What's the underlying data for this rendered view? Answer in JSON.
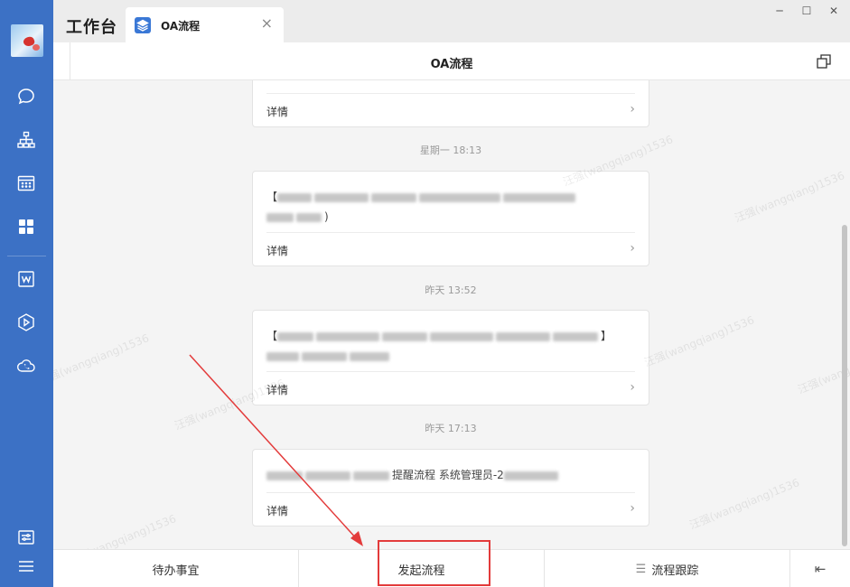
{
  "app": {
    "title": "工作台"
  },
  "tab": {
    "label": "OA流程",
    "close": "×"
  },
  "window": {
    "minimize": "─",
    "maximize": "☐",
    "close": "✕"
  },
  "header": {
    "title": "OA流程"
  },
  "sidebar": {
    "icons": [
      "chat-icon",
      "org-chart-icon",
      "calendar-icon",
      "apps-grid-icon",
      "wps-doc-icon",
      "play-hex-icon",
      "phone-cloud-icon",
      "settings-sliders-icon",
      "menu-icon"
    ]
  },
  "feed": {
    "detail_label": "详情",
    "chevron": "›",
    "items": [
      {
        "time": "",
        "text_prefix": "",
        "text_suffix": ""
      },
      {
        "time": "星期一 18:13",
        "text_prefix": "【",
        "text_suffix": ")"
      },
      {
        "time": "昨天 13:52",
        "text_prefix": "【",
        "text_suffix": "】"
      },
      {
        "time": "昨天 17:13",
        "text_prefix": "【",
        "text_suffix": "提醒流程 系统管理员-2"
      }
    ]
  },
  "watermark_text": "汪强(wangqiang)1536",
  "bottombar": {
    "todo": "待办事宜",
    "start": "发起流程",
    "track": "流程跟踪",
    "track_icon": "☰",
    "collapse_icon": "⇤"
  },
  "colors": {
    "sidebar": "#3c71c5",
    "accent": "#3a78d6",
    "highlight": "#e33b3b"
  }
}
